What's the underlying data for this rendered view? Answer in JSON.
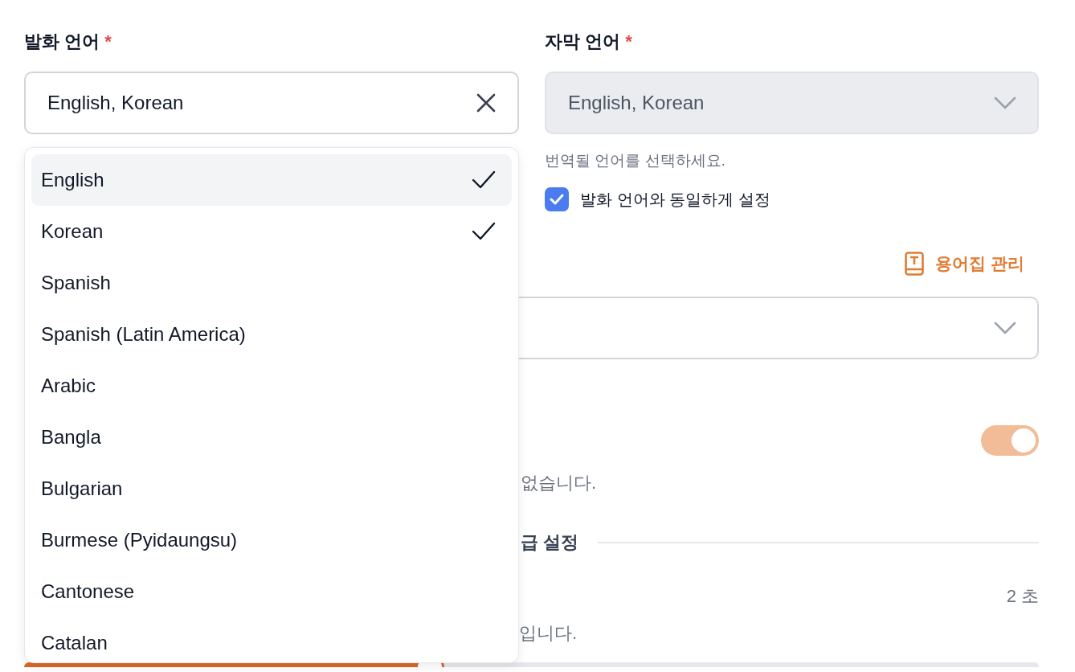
{
  "speech_language": {
    "label": "발화 언어",
    "required_mark": "*",
    "value": "English, Korean"
  },
  "subtitle_language": {
    "label": "자막 언어",
    "required_mark": "*",
    "value": "English, Korean",
    "disabled": true,
    "helper": "번역될 언어를 선택하세요.",
    "same_as_speech": {
      "label": "발화 언어와 동일하게 설정",
      "checked": true
    }
  },
  "glossary": {
    "manage_link": "용어집 관리"
  },
  "toggle_row": {
    "on": true,
    "helper": "없습니다."
  },
  "section": {
    "title": "급 설정"
  },
  "slider_row": {
    "value": "2 초",
    "helper": "입니다.",
    "level": 0.4
  },
  "dropdown": {
    "options": [
      {
        "label": "English",
        "selected": true,
        "highlighted": true
      },
      {
        "label": "Korean",
        "selected": true,
        "highlighted": false
      },
      {
        "label": "Spanish",
        "selected": false,
        "highlighted": false
      },
      {
        "label": "Spanish (Latin America)",
        "selected": false,
        "highlighted": false
      },
      {
        "label": "Arabic",
        "selected": false,
        "highlighted": false
      },
      {
        "label": "Bangla",
        "selected": false,
        "highlighted": false
      },
      {
        "label": "Bulgarian",
        "selected": false,
        "highlighted": false
      },
      {
        "label": "Burmese (Pyidaungsu)",
        "selected": false,
        "highlighted": false
      },
      {
        "label": "Cantonese",
        "selected": false,
        "highlighted": false
      },
      {
        "label": "Catalan",
        "selected": false,
        "highlighted": false
      }
    ]
  }
}
